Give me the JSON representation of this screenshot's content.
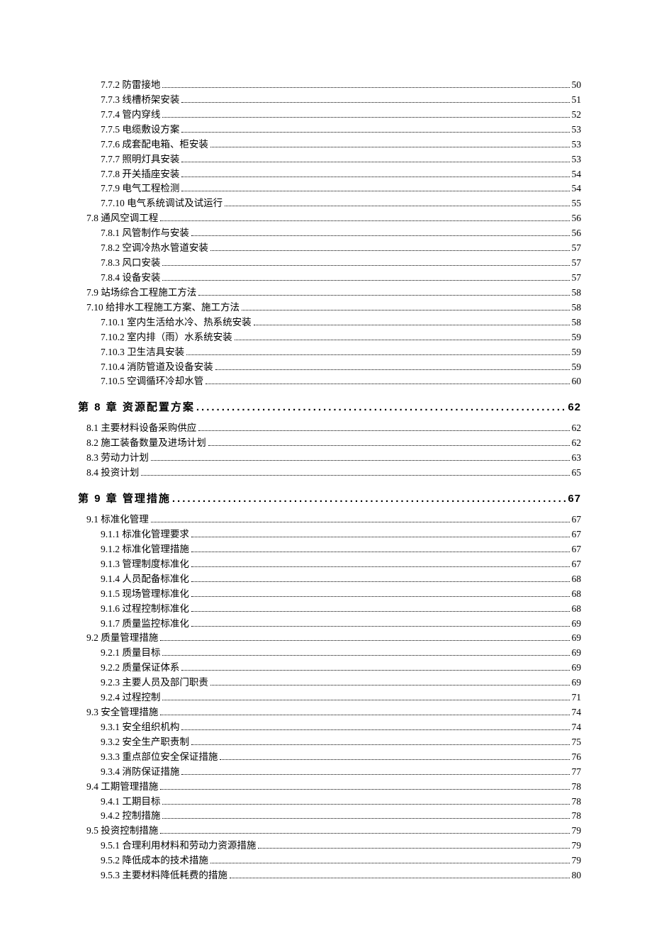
{
  "toc": [
    {
      "level": 2,
      "num": "7.7.2",
      "title": "防雷接地",
      "page": "50"
    },
    {
      "level": 2,
      "num": "7.7.3",
      "title": "线槽桥架安装",
      "page": "51"
    },
    {
      "level": 2,
      "num": "7.7.4",
      "title": "管内穿线",
      "page": "52"
    },
    {
      "level": 2,
      "num": "7.7.5",
      "title": "电缆敷设方案",
      "page": "53"
    },
    {
      "level": 2,
      "num": "7.7.6",
      "title": "成套配电箱、柜安装",
      "page": "53"
    },
    {
      "level": 2,
      "num": "7.7.7",
      "title": "照明灯具安装",
      "page": "53"
    },
    {
      "level": 2,
      "num": "7.7.8",
      "title": "开关插座安装",
      "page": "54"
    },
    {
      "level": 2,
      "num": "7.7.9",
      "title": "电气工程检测",
      "page": "54"
    },
    {
      "level": 2,
      "num": "7.7.10",
      "title": "电气系统调试及试运行",
      "page": "55"
    },
    {
      "level": 1,
      "num": "7.8",
      "title": "通风空调工程",
      "page": "56"
    },
    {
      "level": 2,
      "num": "7.8.1",
      "title": "风管制作与安装",
      "page": "56"
    },
    {
      "level": 2,
      "num": "7.8.2",
      "title": "空调冷热水管道安装",
      "page": "57"
    },
    {
      "level": 2,
      "num": "7.8.3",
      "title": "风口安装",
      "page": "57"
    },
    {
      "level": 2,
      "num": "7.8.4",
      "title": "设备安装",
      "page": "57"
    },
    {
      "level": 1,
      "num": "7.9",
      "title": "站场综合工程施工方法",
      "page": "58"
    },
    {
      "level": 1,
      "num": "7.10",
      "title": "给排水工程施工方案、施工方法",
      "page": "58"
    },
    {
      "level": 2,
      "num": "7.10.1",
      "title": "室内生活给水冷、热系统安装",
      "page": "58"
    },
    {
      "level": 2,
      "num": "7.10.2",
      "title": "室内排（雨）水系统安装",
      "page": "59"
    },
    {
      "level": 2,
      "num": "7.10.3",
      "title": "卫生洁具安装",
      "page": "59"
    },
    {
      "level": 2,
      "num": "7.10.4",
      "title": "消防管道及设备安装",
      "page": "59"
    },
    {
      "level": 2,
      "num": "7.10.5",
      "title": "空调循环冷却水管",
      "page": "60"
    },
    {
      "level": 0,
      "num": "第 8 章",
      "title": "资源配置方案",
      "page": "62"
    },
    {
      "level": 1,
      "num": "8.1",
      "title": "主要材料设备采购供应",
      "page": "62"
    },
    {
      "level": 1,
      "num": "8.2",
      "title": "施工装备数量及进场计划",
      "page": "62"
    },
    {
      "level": 1,
      "num": "8.3",
      "title": "劳动力计划",
      "page": "63"
    },
    {
      "level": 1,
      "num": "8.4",
      "title": "投资计划",
      "page": "65"
    },
    {
      "level": 0,
      "num": "第 9 章",
      "title": "管理措施",
      "page": "67"
    },
    {
      "level": 1,
      "num": "9.1",
      "title": "标准化管理",
      "page": "67"
    },
    {
      "level": 2,
      "num": "9.1.1",
      "title": "标准化管理要求",
      "page": "67"
    },
    {
      "level": 2,
      "num": "9.1.2",
      "title": "标准化管理措施",
      "page": "67"
    },
    {
      "level": 2,
      "num": "9.1.3",
      "title": "管理制度标准化",
      "page": "67"
    },
    {
      "level": 2,
      "num": "9.1.4",
      "title": "人员配备标准化",
      "page": "68"
    },
    {
      "level": 2,
      "num": "9.1.5",
      "title": "现场管理标准化",
      "page": "68"
    },
    {
      "level": 2,
      "num": "9.1.6",
      "title": "过程控制标准化",
      "page": "68"
    },
    {
      "level": 2,
      "num": "9.1.7",
      "title": "质量监控标准化",
      "page": "69"
    },
    {
      "level": 1,
      "num": "9.2",
      "title": "质量管理措施",
      "page": "69"
    },
    {
      "level": 2,
      "num": "9.2.1",
      "title": "质量目标",
      "page": "69"
    },
    {
      "level": 2,
      "num": "9.2.2",
      "title": "质量保证体系",
      "page": "69"
    },
    {
      "level": 2,
      "num": "9.2.3",
      "title": "主要人员及部门职责",
      "page": "69"
    },
    {
      "level": 2,
      "num": "9.2.4",
      "title": "过程控制",
      "page": "71"
    },
    {
      "level": 1,
      "num": "9.3",
      "title": "安全管理措施",
      "page": "74"
    },
    {
      "level": 2,
      "num": "9.3.1",
      "title": "安全组织机构",
      "page": "74"
    },
    {
      "level": 2,
      "num": "9.3.2",
      "title": "安全生产职责制",
      "page": "75"
    },
    {
      "level": 2,
      "num": "9.3.3",
      "title": "重点部位安全保证措施",
      "page": "76"
    },
    {
      "level": 2,
      "num": "9.3.4",
      "title": "消防保证措施",
      "page": "77"
    },
    {
      "level": 1,
      "num": "9.4",
      "title": "工期管理措施",
      "page": "78"
    },
    {
      "level": 2,
      "num": "9.4.1",
      "title": "工期目标",
      "page": "78"
    },
    {
      "level": 2,
      "num": "9.4.2",
      "title": "控制措施",
      "page": "78"
    },
    {
      "level": 1,
      "num": "9.5",
      "title": "投资控制措施",
      "page": "79"
    },
    {
      "level": 2,
      "num": "9.5.1",
      "title": "合理利用材料和劳动力资源措施",
      "page": "79"
    },
    {
      "level": 2,
      "num": "9.5.2",
      "title": "降低成本的技术措施",
      "page": "79"
    },
    {
      "level": 2,
      "num": "9.5.3",
      "title": "主要材料降低耗费的措施",
      "page": "80"
    }
  ]
}
